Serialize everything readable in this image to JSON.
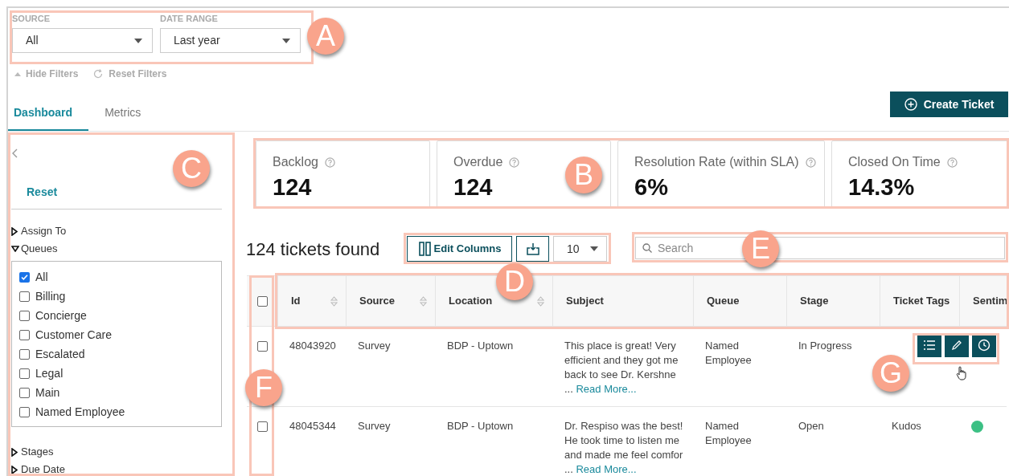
{
  "filters": [
    {
      "label": "SOURCE",
      "value": "All"
    },
    {
      "label": "DATE RANGE",
      "value": "Last year"
    }
  ],
  "filter_actions": [
    {
      "kind": "hide",
      "label": "Hide Filters"
    },
    {
      "kind": "reset",
      "label": "Reset Filters"
    }
  ],
  "tabs": [
    {
      "label": "Dashboard",
      "selected": true
    },
    {
      "label": "Metrics",
      "selected": false
    }
  ],
  "create_button": "Create Ticket",
  "sidebar": {
    "reset": "Reset",
    "sections": [
      {
        "label": "Assign To",
        "expanded": false
      },
      {
        "label": "Queues",
        "expanded": true,
        "options": [
          {
            "label": "All",
            "checked": true
          },
          {
            "label": "Billing",
            "checked": false
          },
          {
            "label": "Concierge",
            "checked": false
          },
          {
            "label": "Customer Care",
            "checked": false
          },
          {
            "label": "Escalated",
            "checked": false
          },
          {
            "label": "Legal",
            "checked": false
          },
          {
            "label": "Main",
            "checked": false
          },
          {
            "label": "Named Employee",
            "checked": false
          }
        ]
      },
      {
        "label": "Stages",
        "expanded": false
      },
      {
        "label": "Due Date",
        "expanded": false
      }
    ]
  },
  "kpis": [
    {
      "label": "Backlog",
      "value": "124"
    },
    {
      "label": "Overdue",
      "value": "124"
    },
    {
      "label": "Resolution Rate (within SLA)",
      "value": "6%"
    },
    {
      "label": "Closed On Time",
      "value": "14.3%"
    }
  ],
  "toolbar": {
    "count": "124 tickets found",
    "edit_columns": "Edit Columns",
    "page_size": "10",
    "search_placeholder": "Search"
  },
  "table": {
    "select_all_checked": false,
    "columns": [
      {
        "label": "Id",
        "sortable": true
      },
      {
        "label": "Source",
        "sortable": true
      },
      {
        "label": "Location",
        "sortable": true
      },
      {
        "label": "Subject",
        "sortable": false
      },
      {
        "label": "Queue",
        "sortable": false
      },
      {
        "label": "Stage",
        "sortable": false
      },
      {
        "label": "Ticket Tags",
        "sortable": false
      },
      {
        "label": "Sentim",
        "sortable": false
      }
    ],
    "rows": [
      {
        "checked": false,
        "id": "48043920",
        "source": "Survey",
        "location": "BDP - Uptown",
        "subject": "This place is great! Very efficient and they got me back to see Dr. Kershne ...",
        "link": "Read More...",
        "queue": "Named Employee",
        "stage": "In Progress",
        "hovered": true
      },
      {
        "checked": false,
        "id": "48045344",
        "source": "Survey",
        "location": "BDP - Uptown",
        "subject": "Dr. Respiso was the best! He took time to listen me and made me feel comfor ...",
        "link": "Read More...",
        "queue": "Named Employee",
        "stage": "Open",
        "tags": "Kudos",
        "sentiment": {
          "color": "#3cc084"
        },
        "hovered": false
      }
    ]
  },
  "callouts": [
    {
      "label": "A"
    },
    {
      "label": "B"
    },
    {
      "label": "C"
    },
    {
      "label": "D"
    },
    {
      "label": "E"
    },
    {
      "label": "F"
    },
    {
      "label": "G"
    }
  ]
}
